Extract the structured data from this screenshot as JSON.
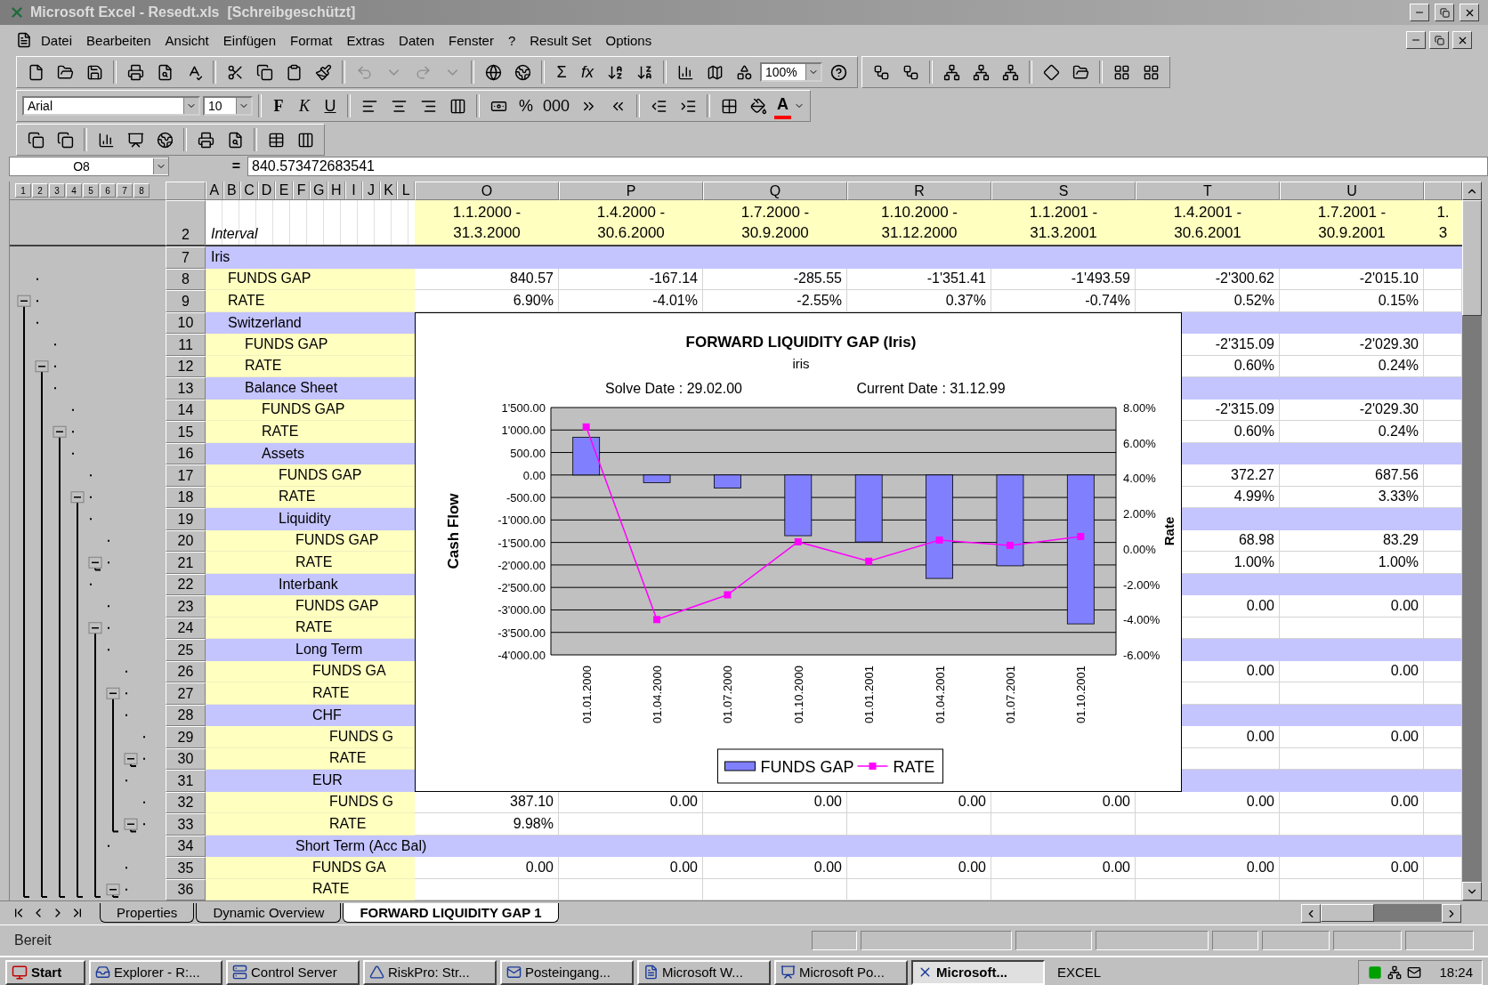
{
  "window": {
    "title": "Microsoft Excel - Resedt.xls  [Schreibgeschützt]"
  },
  "menu": [
    "Datei",
    "Bearbeiten",
    "Ansicht",
    "Einfügen",
    "Format",
    "Extras",
    "Daten",
    "Fenster",
    "?",
    "Result Set",
    "Options"
  ],
  "toolbar": {
    "sum": "Σ",
    "function": "fx",
    "zoom": "100%"
  },
  "formatting": {
    "font": "Arial",
    "size": "10",
    "bold": "F",
    "italic": "K",
    "underline": "U",
    "percent": "%",
    "thousands": "000",
    "font_color": "A"
  },
  "formula_bar": {
    "name_box": "O8",
    "equals": "=",
    "value": "840.573472683541"
  },
  "outline_levels": [
    "1",
    "2",
    "3",
    "4",
    "5",
    "6",
    "7",
    "8"
  ],
  "sheet": {
    "narrow_columns": [
      "A",
      "B",
      "C",
      "D",
      "E",
      "F",
      "G",
      "H",
      "I",
      "J",
      "K",
      "L"
    ],
    "columns": [
      {
        "letter": "O",
        "period": [
          "1.1.2000 -",
          "31.3.2000"
        ]
      },
      {
        "letter": "P",
        "period": [
          "1.4.2000 -",
          "30.6.2000"
        ]
      },
      {
        "letter": "Q",
        "period": [
          "1.7.2000 -",
          "30.9.2000"
        ]
      },
      {
        "letter": "R",
        "period": [
          "1.10.2000 -",
          "31.12.2000"
        ]
      },
      {
        "letter": "S",
        "period": [
          "1.1.2001 -",
          "31.3.2001"
        ]
      },
      {
        "letter": "T",
        "period": [
          "1.4.2001 -",
          "30.6.2001"
        ]
      },
      {
        "letter": "U",
        "period": [
          "1.7.2001 -",
          "30.9.2001"
        ]
      }
    ],
    "partial_column": {
      "period": [
        "1.",
        "3"
      ]
    },
    "header_row": {
      "row": "2",
      "label": "Interval"
    },
    "rows": [
      {
        "row": "7",
        "label": "Iris",
        "kind": "group",
        "children": [
          {
            "row": "8",
            "label": "FUNDS GAP",
            "kind": "line",
            "values": [
              "840.57",
              "-167.14",
              "-285.55",
              "-1'351.41",
              "-1'493.59",
              "-2'300.62",
              "-2'015.10"
            ]
          },
          {
            "row": "9",
            "label": "RATE",
            "kind": "line",
            "values": [
              "6.90%",
              "-4.01%",
              "-2.55%",
              "0.37%",
              "-0.74%",
              "0.52%",
              "0.15%"
            ]
          },
          {
            "row": "10",
            "label": "Switzerland",
            "kind": "group",
            "children": [
              {
                "row": "11",
                "label": "FUNDS GAP",
                "kind": "line",
                "right_values": [
                  "-2'315.09",
                  "-2'029.30"
                ]
              },
              {
                "row": "12",
                "label": "RATE",
                "kind": "line",
                "right_values": [
                  "0.60%",
                  "0.24%"
                ]
              },
              {
                "row": "13",
                "label": "Balance Sheet",
                "kind": "group",
                "children": [
                  {
                    "row": "14",
                    "label": "FUNDS GAP",
                    "kind": "line",
                    "right_values": [
                      "-2'315.09",
                      "-2'029.30"
                    ]
                  },
                  {
                    "row": "15",
                    "label": "RATE",
                    "kind": "line",
                    "right_values": [
                      "0.60%",
                      "0.24%"
                    ]
                  },
                  {
                    "row": "16",
                    "label": "Assets",
                    "kind": "group",
                    "children": [
                      {
                        "row": "17",
                        "label": "FUNDS GAP",
                        "kind": "line",
                        "right_values": [
                          "372.27",
                          "687.56"
                        ]
                      },
                      {
                        "row": "18",
                        "label": "RATE",
                        "kind": "line",
                        "right_values": [
                          "4.99%",
                          "3.33%"
                        ]
                      },
                      {
                        "row": "19",
                        "label": "Liquidity",
                        "kind": "group",
                        "children": [
                          {
                            "row": "20",
                            "label": "FUNDS GAP",
                            "kind": "line",
                            "right_values": [
                              "68.98",
                              "83.29"
                            ]
                          },
                          {
                            "row": "21",
                            "label": "RATE",
                            "kind": "line",
                            "right_values": [
                              "1.00%",
                              "1.00%"
                            ]
                          }
                        ]
                      },
                      {
                        "row": "22",
                        "label": "Interbank",
                        "kind": "group",
                        "children": [
                          {
                            "row": "23",
                            "label": "FUNDS GAP",
                            "kind": "line",
                            "right_values": [
                              "0.00",
                              "0.00"
                            ]
                          },
                          {
                            "row": "24",
                            "label": "RATE",
                            "kind": "line"
                          },
                          {
                            "row": "25",
                            "label": "Long Term",
                            "kind": "group",
                            "children": [
                              {
                                "row": "26",
                                "label": "FUNDS GA",
                                "kind": "line",
                                "right_values": [
                                  "0.00",
                                  "0.00"
                                ]
                              },
                              {
                                "row": "27",
                                "label": "RATE",
                                "kind": "line"
                              },
                              {
                                "row": "28",
                                "label": "CHF",
                                "kind": "group",
                                "children": [
                                  {
                                    "row": "29",
                                    "label": "FUNDS G",
                                    "kind": "line",
                                    "right_values": [
                                      "0.00",
                                      "0.00"
                                    ]
                                  },
                                  {
                                    "row": "30",
                                    "label": "RATE",
                                    "kind": "line"
                                  }
                                ]
                              },
                              {
                                "row": "31",
                                "label": "EUR",
                                "kind": "group",
                                "children": [
                                  {
                                    "row": "32",
                                    "label": "FUNDS G",
                                    "kind": "line",
                                    "values": [
                                      "387.10",
                                      "0.00",
                                      "0.00",
                                      "0.00",
                                      "0.00",
                                      "0.00",
                                      "0.00"
                                    ]
                                  },
                                  {
                                    "row": "33",
                                    "label": "RATE",
                                    "kind": "line",
                                    "values": [
                                      "9.98%"
                                    ]
                                  }
                                ]
                              }
                            ]
                          },
                          {
                            "row": "34",
                            "label": "Short Term (Acc Bal)",
                            "kind": "group",
                            "children": [
                              {
                                "row": "35",
                                "label": "FUNDS GA",
                                "kind": "line",
                                "values": [
                                  "0.00",
                                  "0.00",
                                  "0.00",
                                  "0.00",
                                  "0.00",
                                  "0.00",
                                  "0.00"
                                ]
                              },
                              {
                                "row": "36",
                                "label": "RATE",
                                "kind": "line"
                              }
                            ]
                          }
                        ]
                      }
                    ]
                  }
                ]
              }
            ]
          }
        ]
      }
    ]
  },
  "chart": {
    "subtitle": "iris",
    "solve_date": "Solve Date : 29.02.00",
    "current_date": "Current Date : 31.12.99",
    "chart_data": {
      "type": "bar",
      "grid": true,
      "legend": "bottom",
      "title": "FORWARD LIQUIDITY GAP (Iris)",
      "ylabel": "Cash Flow",
      "y2label": "Rate",
      "categories": [
        "01.01.2000",
        "01.04.2000",
        "01.07.2000",
        "01.10.2000",
        "01.01.2001",
        "01.04.2001",
        "01.07.2001",
        "01.10.2001"
      ],
      "series": [
        {
          "name": "FUNDS GAP",
          "color": "#8080ff",
          "values": [
            840,
            -170,
            -290,
            -1350,
            -1490,
            -2300,
            -2020,
            -3310
          ]
        },
        {
          "name": "RATE",
          "color": "#ff00ff",
          "type": "line",
          "axis": "y2",
          "marker": "square",
          "values": [
            6.9,
            -4.0,
            -2.6,
            0.4,
            -0.7,
            0.5,
            0.2,
            0.7
          ]
        }
      ],
      "ylim": [
        -4000,
        1500
      ],
      "yticks": [
        {
          "value": 1500,
          "label": "1'500.00"
        },
        {
          "value": 1000,
          "label": "1'000.00"
        },
        {
          "value": 500,
          "label": "500.00"
        },
        {
          "value": 0,
          "label": "0.00"
        },
        {
          "value": -500,
          "label": "-500.00"
        },
        {
          "value": -1000,
          "label": "-1'000.00"
        },
        {
          "value": -1500,
          "label": "-1'500.00"
        },
        {
          "value": -2000,
          "label": "-2'000.00"
        },
        {
          "value": -2500,
          "label": "-2'500.00"
        },
        {
          "value": -3000,
          "label": "-3'000.00"
        },
        {
          "value": -3500,
          "label": "-3'500.00"
        },
        {
          "value": -4000,
          "label": "-4'000.00"
        }
      ],
      "y2lim": [
        -6,
        8
      ],
      "y2ticks": [
        {
          "value": 8,
          "label": "8.00%"
        },
        {
          "value": 6,
          "label": "6.00%"
        },
        {
          "value": 4,
          "label": "4.00%"
        },
        {
          "value": 2,
          "label": "2.00%"
        },
        {
          "value": 0,
          "label": "0.00%"
        },
        {
          "value": -2,
          "label": "-2.00%"
        },
        {
          "value": -4,
          "label": "-4.00%"
        },
        {
          "value": -6,
          "label": "-6.00%"
        }
      ]
    }
  },
  "sheet_tabs": [
    {
      "label": "Properties",
      "selected": false
    },
    {
      "label": "Dynamic Overview",
      "selected": false
    },
    {
      "label": "FORWARD LIQUIDITY GAP 1",
      "selected": true
    }
  ],
  "status_bar": {
    "text": "Bereit"
  },
  "taskbar": {
    "start": "Start",
    "buttons": [
      {
        "label": "Explorer - R:...",
        "selected": false
      },
      {
        "label": "Control Server",
        "selected": false
      },
      {
        "label": "RiskPro: Str...",
        "selected": false
      },
      {
        "label": "Posteingang...",
        "selected": false
      },
      {
        "label": "Microsoft W...",
        "selected": false
      },
      {
        "label": "Microsoft Po...",
        "selected": false
      },
      {
        "label": "Microsoft...",
        "selected": true
      }
    ],
    "label": "EXCEL",
    "clock": "18:24"
  }
}
